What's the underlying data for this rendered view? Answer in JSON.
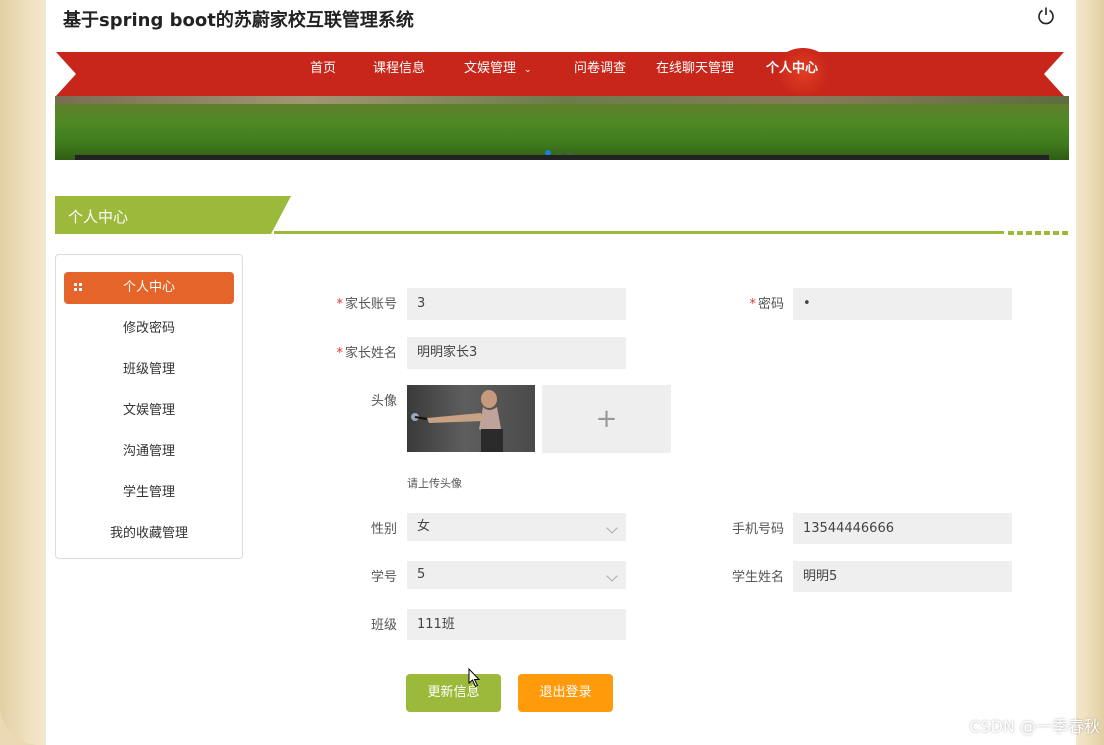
{
  "app": {
    "title": "基于spring boot的苏蔚家校互联管理系统"
  },
  "nav": {
    "items": [
      {
        "label": "首页"
      },
      {
        "label": "课程信息"
      },
      {
        "label": "文娱管理"
      },
      {
        "label": "问卷调查"
      },
      {
        "label": "在线聊天管理"
      },
      {
        "label": "个人中心"
      }
    ]
  },
  "section": {
    "title": "个人中心"
  },
  "sidebar": {
    "items": [
      {
        "label": "个人中心"
      },
      {
        "label": "修改密码"
      },
      {
        "label": "班级管理"
      },
      {
        "label": "文娱管理"
      },
      {
        "label": "沟通管理"
      },
      {
        "label": "学生管理"
      },
      {
        "label": "我的收藏管理"
      }
    ]
  },
  "form": {
    "account_label": "家长账号",
    "account_value": "3",
    "password_label": "密码",
    "password_value": "•",
    "name_label": "家长姓名",
    "name_value": "明明家长3",
    "avatar_label": "头像",
    "upload_hint": "请上传头像",
    "upload_plus": "+",
    "gender_label": "性别",
    "gender_value": "女",
    "phone_label": "手机号码",
    "phone_value": "13544446666",
    "student_no_label": "学号",
    "student_no_value": "5",
    "student_name_label": "学生姓名",
    "student_name_value": "明明5",
    "class_label": "班级",
    "class_value": "111班",
    "required_mark": "*"
  },
  "buttons": {
    "update": "更新信息",
    "logout": "退出登录"
  },
  "watermark": "CSDN @一季春秋",
  "colors": {
    "nav_red": "#c8261a",
    "accent_green": "#9bba3b",
    "active_orange": "#e5642a",
    "logout_orange": "#ff9a0a"
  }
}
